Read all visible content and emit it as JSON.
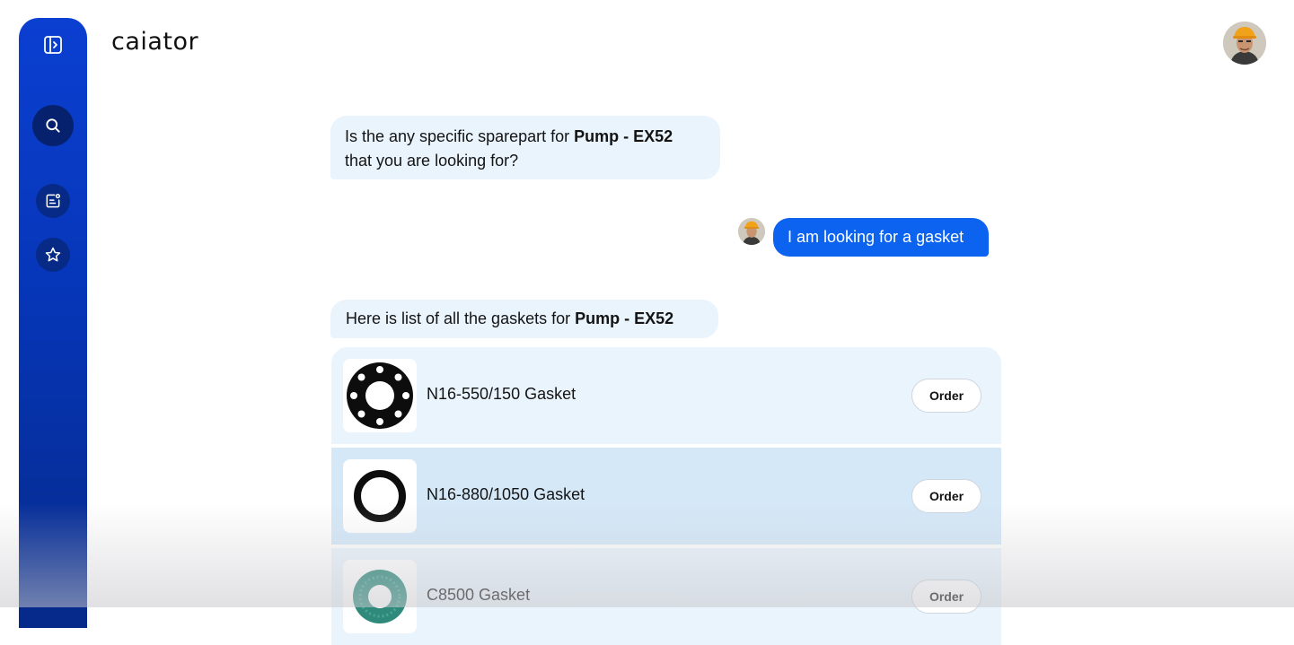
{
  "app": {
    "logo_text": "caiator"
  },
  "sidebar": {
    "items": [
      {
        "icon": "sidebar-toggle-icon"
      },
      {
        "icon": "search-icon"
      },
      {
        "icon": "notes-icon"
      },
      {
        "icon": "star-icon"
      }
    ]
  },
  "chat": {
    "bot_message_1": {
      "text_before": "Is the any specific sparepart for ",
      "bold": "Pump - EX52",
      "text_after": "that you are looking for?"
    },
    "user_message": {
      "text": "I am looking for a gasket"
    },
    "bot_message_2": {
      "text_before": "Here is list of all the gaskets for ",
      "bold": "Pump - EX52"
    }
  },
  "gaskets": [
    {
      "name": "N16-550/150 Gasket",
      "order_label": "Order",
      "icon": "flange-gasket-icon"
    },
    {
      "name": "N16-880/1050 Gasket",
      "order_label": "Order",
      "icon": "ring-gasket-icon"
    },
    {
      "name": "C8500 Gasket",
      "order_label": "Order",
      "icon": "fiber-gasket-icon"
    }
  ],
  "colors": {
    "sidebar": "#0636b8",
    "user_bubble": "#0b63f0",
    "bot_bubble": "#eaf4fd",
    "row_highlight": "#d5e8f8"
  }
}
